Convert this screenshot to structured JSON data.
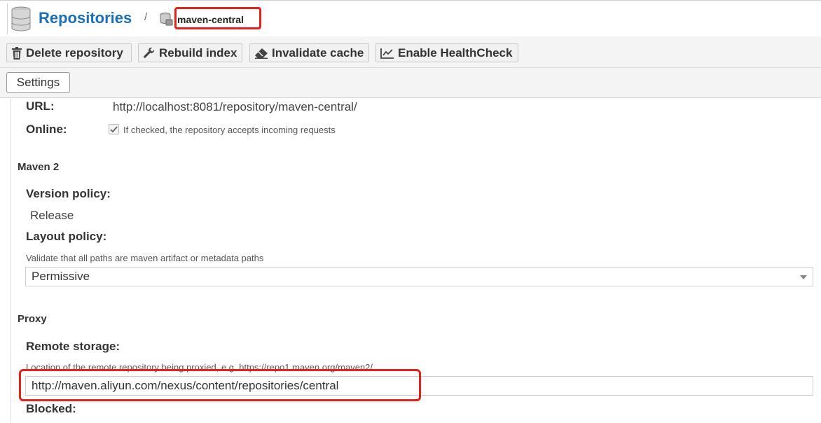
{
  "header": {
    "title": "Repositories",
    "separator": "/",
    "crumb": "maven-central",
    "highlight_color": "#e8201a",
    "title_color": "#1a6fb8"
  },
  "toolbar": {
    "delete_label": "Delete repository",
    "rebuild_label": "Rebuild index",
    "invalidate_label": "Invalidate cache",
    "healthcheck_label": "Enable HealthCheck"
  },
  "tabs": [
    {
      "label": "Settings"
    }
  ],
  "settings": {
    "url_label": "URL:",
    "url_value": "http://localhost:8081/repository/maven-central/",
    "online_label": "Online:",
    "online_checked": true,
    "online_help": "If checked, the repository accepts incoming requests",
    "maven_section": "Maven 2",
    "version_policy_label": "Version policy:",
    "version_policy_value": "Release",
    "layout_policy_label": "Layout policy:",
    "layout_policy_help": "Validate that all paths are maven artifact or metadata paths",
    "layout_policy_value": "Permissive",
    "proxy_section": "Proxy",
    "remote_storage_label": "Remote storage:",
    "remote_storage_help": "Location of the remote repository being proxied, e.g. https://repo1.maven.org/maven2/",
    "remote_storage_value": "http://maven.aliyun.com/nexus/content/repositories/central",
    "blocked_label": "Blocked:"
  },
  "icons": {
    "header": "database-icon",
    "crumb": "repository-icon",
    "delete": "trash-icon",
    "rebuild": "wrench-icon",
    "invalidate": "eraser-icon",
    "healthcheck": "chart-line-icon",
    "checkbox": "checkmark-icon",
    "dropdown": "caret-down-icon"
  }
}
